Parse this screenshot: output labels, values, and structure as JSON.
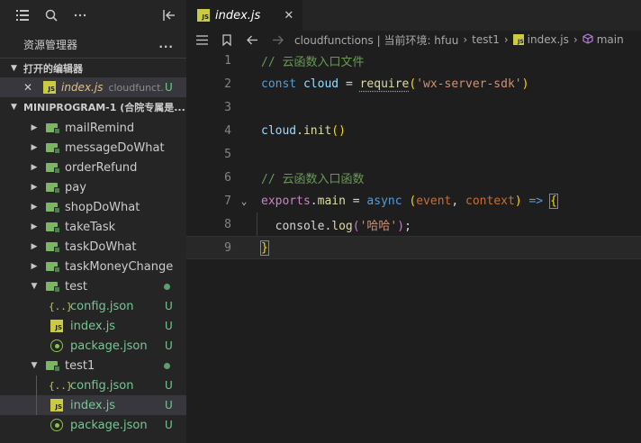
{
  "sidebar": {
    "explorer_title": "资源管理器",
    "more": "...",
    "open_editors": {
      "title": "打开的编辑器",
      "items": [
        {
          "close": "✕",
          "name": "index.js",
          "dir": "cloudfunct...",
          "status": "U"
        }
      ]
    },
    "workspace": {
      "title": "MINIPROGRAM-1 (合院专属是..."
    },
    "tree": [
      {
        "label": "mailRemind",
        "kind": "folder"
      },
      {
        "label": "messageDoWhat",
        "kind": "folder"
      },
      {
        "label": "orderRefund",
        "kind": "folder"
      },
      {
        "label": "pay",
        "kind": "folder"
      },
      {
        "label": "shopDoWhat",
        "kind": "folder"
      },
      {
        "label": "takeTask",
        "kind": "folder"
      },
      {
        "label": "taskDoWhat",
        "kind": "folder"
      },
      {
        "label": "taskMoneyChange",
        "kind": "folder"
      },
      {
        "label": "test",
        "kind": "folder-open"
      },
      {
        "label": "config.json",
        "kind": "json",
        "status": "U"
      },
      {
        "label": "index.js",
        "kind": "js",
        "status": "U"
      },
      {
        "label": "package.json",
        "kind": "pkg",
        "status": "U"
      },
      {
        "label": "test1",
        "kind": "folder-open"
      },
      {
        "label": "config.json",
        "kind": "json",
        "status": "U"
      },
      {
        "label": "index.js",
        "kind": "js",
        "status": "U"
      },
      {
        "label": "package.json",
        "kind": "pkg",
        "status": "U"
      }
    ]
  },
  "editor": {
    "tab": {
      "name": "index.js",
      "close": "✕",
      "icon_text": "JS"
    },
    "breadcrumb": {
      "path": [
        "cloudfunctions | 当前环境: hfuu",
        "test1",
        "index.js",
        "main"
      ],
      "separator": "›"
    },
    "lines": [
      {
        "n": "1",
        "text": "// 云函数入口文件"
      },
      {
        "n": "2",
        "text": "const cloud = require('wx-server-sdk')"
      },
      {
        "n": "3",
        "text": ""
      },
      {
        "n": "4",
        "text": "cloud.init()"
      },
      {
        "n": "5",
        "text": ""
      },
      {
        "n": "6",
        "text": "// 云函数入口函数"
      },
      {
        "n": "7",
        "text": "exports.main = async (event, context) => {"
      },
      {
        "n": "8",
        "text": "  console.log('哈哈');"
      },
      {
        "n": "9",
        "text": "}"
      }
    ]
  }
}
